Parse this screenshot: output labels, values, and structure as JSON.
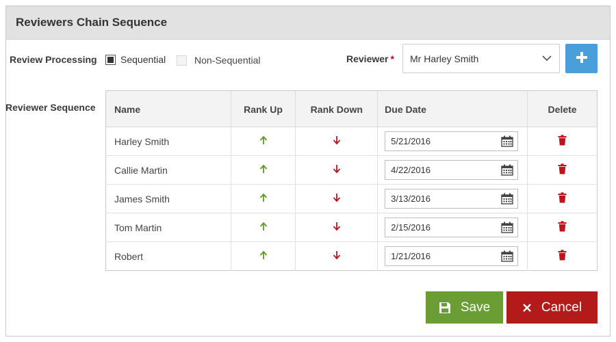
{
  "panel": {
    "title": "Reviewers Chain Sequence"
  },
  "processing": {
    "label": "Review Processing",
    "options": [
      {
        "label": "Sequential",
        "checked": true
      },
      {
        "label": "Non-Sequential",
        "checked": false
      }
    ]
  },
  "reviewer": {
    "label": "Reviewer",
    "required_mark": "*",
    "selected": "Mr Harley Smith",
    "add_icon": "plus-icon"
  },
  "sequence": {
    "label": "Reviewer Sequence",
    "columns": [
      "Name",
      "Rank Up",
      "Rank Down",
      "Due Date",
      "Delete"
    ],
    "rows": [
      {
        "name": "Harley Smith",
        "due_date": "5/21/2016"
      },
      {
        "name": "Callie Martin",
        "due_date": "4/22/2016"
      },
      {
        "name": "James Smith",
        "due_date": "3/13/2016"
      },
      {
        "name": "Tom Martin",
        "due_date": "2/15/2016"
      },
      {
        "name": "Robert",
        "due_date": "1/21/2016"
      }
    ]
  },
  "actions": {
    "save_label": "Save",
    "cancel_label": "Cancel"
  },
  "colors": {
    "header_bg": "#e2e2e2",
    "accent_blue": "#4a9fd8",
    "save_green": "#6a9e35",
    "cancel_red": "#b31b1b",
    "rank_up": "#5a9e1e",
    "rank_down": "#c0141c",
    "delete_red": "#c0141c"
  },
  "icons": {
    "rank_up": "arrow-up-icon",
    "rank_down": "arrow-down-icon",
    "calendar": "calendar-icon",
    "delete": "trash-icon",
    "save": "floppy-disk-icon",
    "cancel": "close-icon"
  }
}
